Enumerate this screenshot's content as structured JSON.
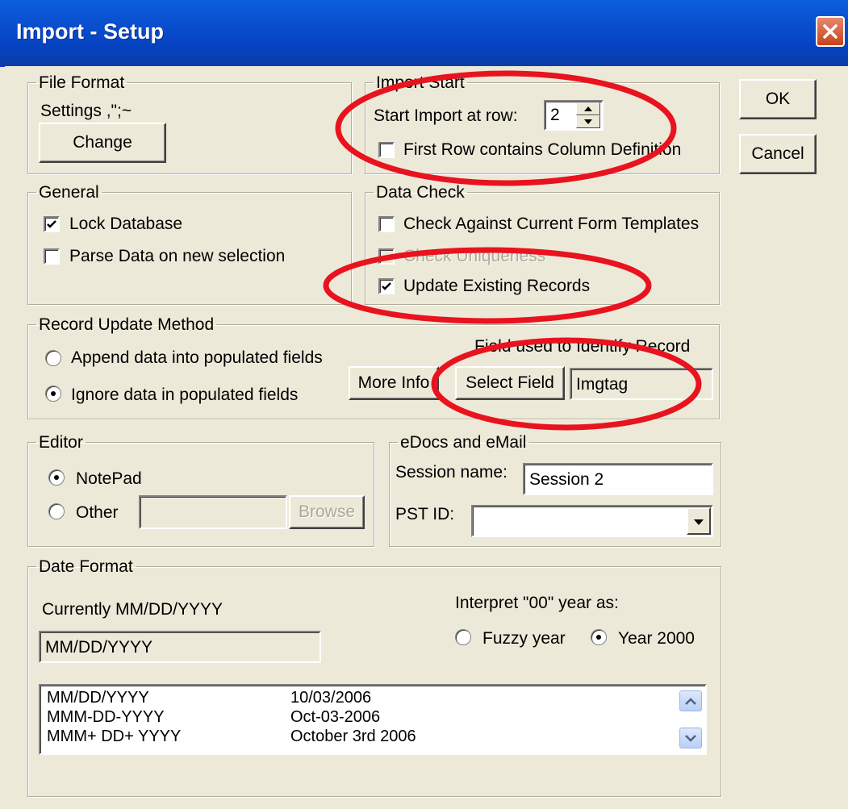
{
  "window": {
    "title": "Import - Setup",
    "close_glyph": "×"
  },
  "buttons": {
    "ok": "OK",
    "cancel": "Cancel"
  },
  "file_format": {
    "legend": "File Format",
    "settings": "Settings ,\";~",
    "change": "Change"
  },
  "import_start": {
    "legend": "Import Start",
    "start_label": "Start Import at row:",
    "start_value": "2",
    "first_row_label": "First Row contains Column Definition",
    "first_row_checked": false
  },
  "general": {
    "legend": "General",
    "lock_label": "Lock Database",
    "lock_checked": true,
    "parse_label": "Parse Data on new selection",
    "parse_checked": false
  },
  "data_check": {
    "legend": "Data Check",
    "check_templates": "Check Against Current Form Templates",
    "check_templates_checked": false,
    "check_uniqueness": "Check Uniqueness",
    "check_uniqueness_disabled": true,
    "update_existing": "Update Existing Records",
    "update_existing_checked": true
  },
  "record_update": {
    "legend": "Record Update Method",
    "append_label": "Append data into populated fields",
    "ignore_label": "Ignore data in populated fields",
    "selected": "ignore",
    "field_caption": "Field used to Identify Record",
    "more_info": "More Info",
    "select_field": "Select Field",
    "field_value": "Imgtag"
  },
  "editor": {
    "legend": "Editor",
    "notepad_label": "NotePad",
    "other_label": "Other",
    "selected": "notepad",
    "other_value": "",
    "browse": "Browse"
  },
  "edocs": {
    "legend": "eDocs and eMail",
    "session_label": "Session name:",
    "session_value": "Session 2",
    "pst_label": "PST ID:",
    "pst_value": ""
  },
  "date_format": {
    "legend": "Date Format",
    "currently": "Currently MM/DD/YYYY",
    "current_value": "MM/DD/YYYY",
    "interpret_label": "Interpret \"00\" year as:",
    "fuzzy_label": "Fuzzy year",
    "year2000_label": "Year 2000",
    "selected": "year2000",
    "formats": [
      {
        "format": "MM/DD/YYYY",
        "example": "10/03/2006"
      },
      {
        "format": "MMM-DD-YYYY",
        "example": "Oct-03-2006"
      },
      {
        "format": "MMM+ DD+ YYYY",
        "example": "October 3rd 2006"
      }
    ]
  },
  "colors": {
    "annotation": "#e8131f",
    "titlebar": "#0a4fcf",
    "face": "#ece9d8"
  },
  "icons": {
    "close": "close-icon",
    "spin_up": "spin-up-icon",
    "spin_down": "spin-down-icon",
    "dropdown": "chevron-down-icon",
    "scroll_up": "scroll-up-icon",
    "scroll_down": "scroll-down-icon",
    "check": "checkmark-icon"
  }
}
